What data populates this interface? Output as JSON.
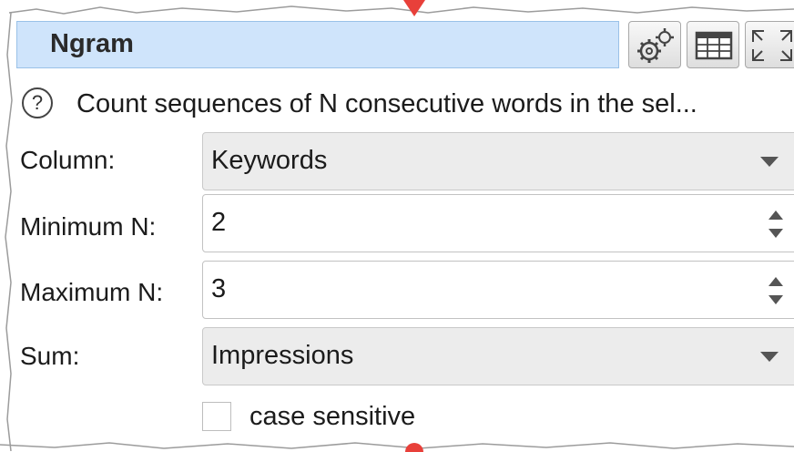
{
  "panel": {
    "title": "Ngram",
    "description": "Count sequences of N consecutive words in the sel...",
    "help_symbol": "?"
  },
  "toolbar": {
    "buttons": [
      {
        "icon": "gears-icon"
      },
      {
        "icon": "table-icon"
      },
      {
        "icon": "maximize-icon"
      }
    ]
  },
  "form": {
    "column": {
      "label": "Column:",
      "value": "Keywords"
    },
    "minimum_n": {
      "label": "Minimum N:",
      "value": "2"
    },
    "maximum_n": {
      "label": "Maximum N:",
      "value": "3"
    },
    "sum": {
      "label": "Sum:",
      "value": "Impressions"
    },
    "case_sensitive": {
      "label": "case sensitive",
      "checked": false
    }
  },
  "colors": {
    "title_bg": "#cfe4fb",
    "accent_red": "#e8403a"
  }
}
